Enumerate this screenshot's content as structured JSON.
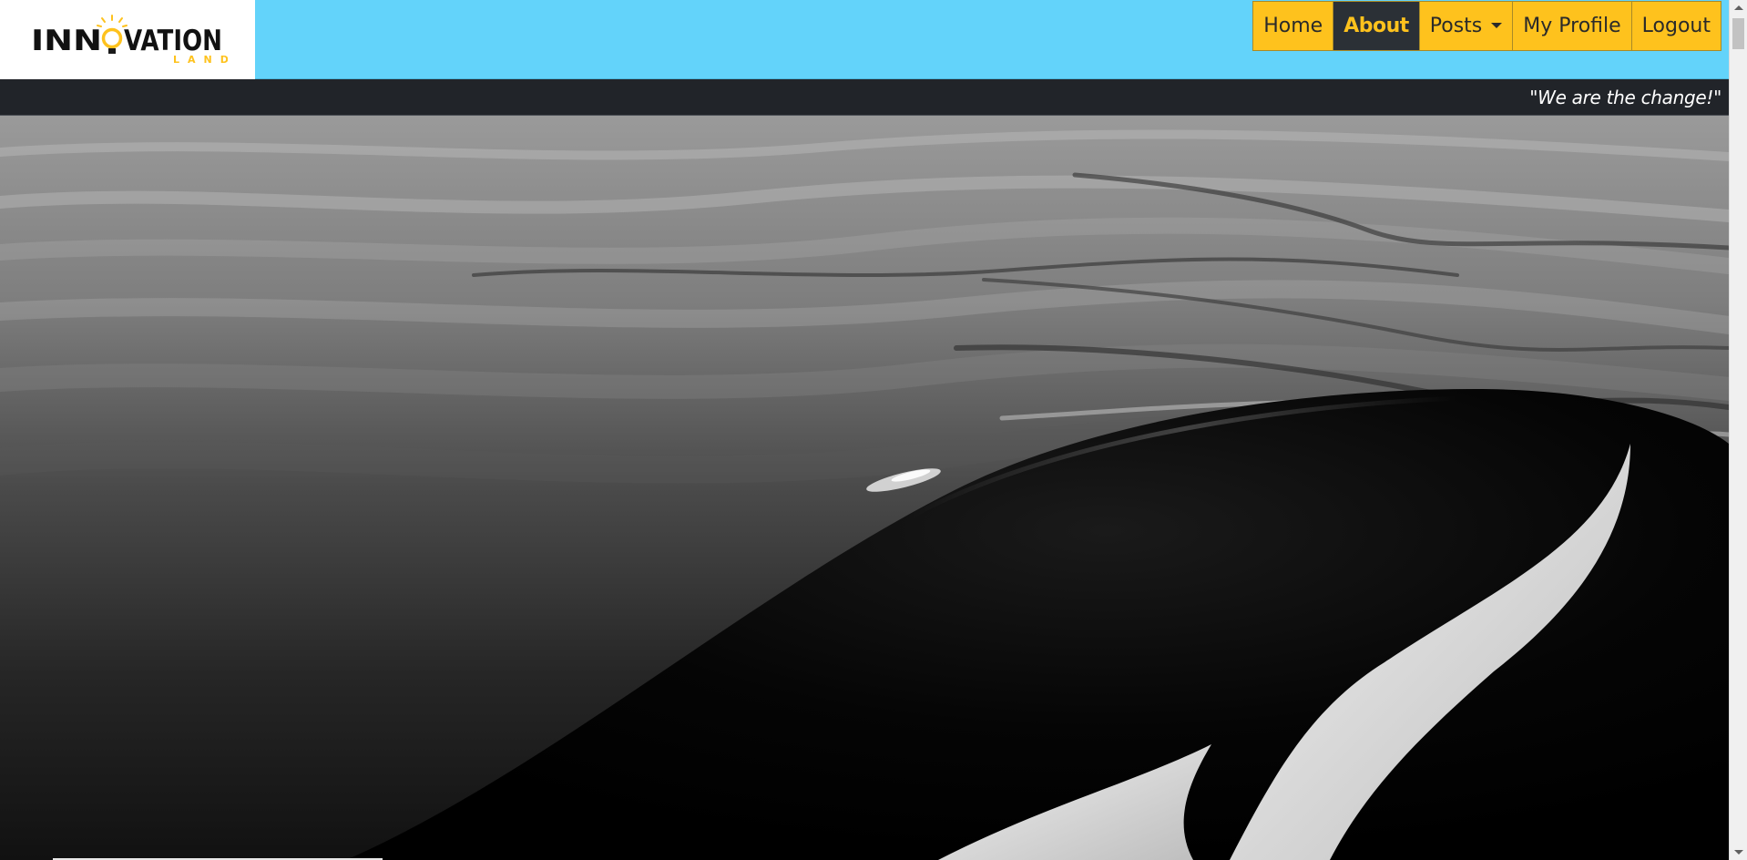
{
  "brand": {
    "logo_text": "INNOVATION",
    "logo_subtext": "LAND",
    "colors": {
      "navbar_bg": "#63d3fa",
      "nav_item_bg": "#fec21d",
      "nav_active_bg": "#2b3036",
      "nav_active_text": "#fec21d",
      "tagline_bar_bg": "#212429"
    }
  },
  "nav": {
    "items": [
      {
        "label": "Home",
        "active": false
      },
      {
        "label": "About",
        "active": true
      },
      {
        "label": "Posts",
        "active": false,
        "dropdown": true,
        "icon": "caret-down-icon"
      },
      {
        "label": "My Profile",
        "active": false
      },
      {
        "label": "Logout",
        "active": false
      }
    ]
  },
  "tagline": "\"We are the change!\"",
  "hero": {
    "image": "black-and-white-orca-surfacing-in-water"
  }
}
